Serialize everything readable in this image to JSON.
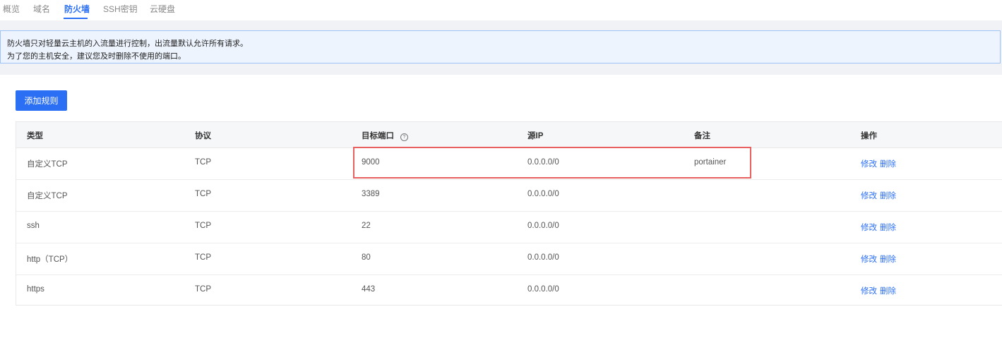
{
  "tabs": [
    "概览",
    "域名",
    "防火墙",
    "SSH密钥",
    "云硬盘"
  ],
  "active_tab": 2,
  "notice": {
    "line1": "防火墙只对轻量云主机的入流量进行控制，出流量默认允许所有请求。",
    "line2": "为了您的主机安全，建议您及时删除不使用的端口。"
  },
  "add_rule_label": "添加规则",
  "table": {
    "headers": {
      "type": "类型",
      "protocol": "协议",
      "port": "目标端口",
      "source": "源IP",
      "note": "备注",
      "action": "操作"
    },
    "help_icon": "help-circle-icon",
    "rows": [
      {
        "type": "自定义TCP",
        "protocol": "TCP",
        "port": "9000",
        "source": "0.0.0.0/0",
        "note": "portainer"
      },
      {
        "type": "自定义TCP",
        "protocol": "TCP",
        "port": "3389",
        "source": "0.0.0.0/0",
        "note": ""
      },
      {
        "type": "ssh",
        "protocol": "TCP",
        "port": "22",
        "source": "0.0.0.0/0",
        "note": ""
      },
      {
        "type": "http（TCP）",
        "protocol": "TCP",
        "port": "80",
        "source": "0.0.0.0/0",
        "note": ""
      },
      {
        "type": "https",
        "protocol": "TCP",
        "port": "443",
        "source": "0.0.0.0/0",
        "note": ""
      }
    ],
    "edit_label": "修改",
    "delete_label": "删除"
  },
  "colors": {
    "accent": "#2b6ff5",
    "highlight_border": "#e8605f",
    "notice_bg": "#edf4fe",
    "notice_border": "#9fc2f7"
  }
}
